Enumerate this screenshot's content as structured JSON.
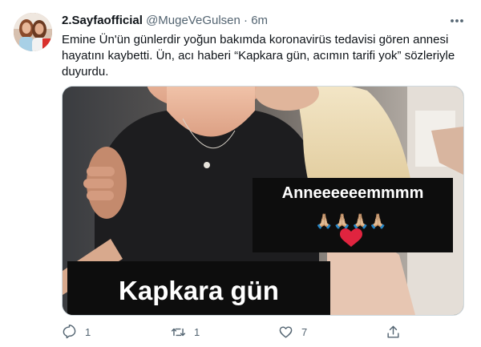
{
  "tweet": {
    "display_name": "2.Sayfaofficial",
    "handle": "@MugeVeGulsen",
    "separator": "·",
    "time": "6m",
    "text": "Emine Ün'ün günlerdir yoğun bakımda koronavirüs tedavisi gören annesi\nhayatını kaybetti. Ün, acı haberi “Kapkara gün, acımın tarifi yok” sözleriyle\nduyurdu.",
    "media": {
      "story_caption": "Anneeeeeemmmm",
      "emoji_line": "🙏🏼🙏🏼🙏🏼🙏🏼",
      "heart": "❤️",
      "bottom_caption": "Kapkara gün"
    },
    "actions": {
      "reply_count": "1",
      "retweet_count": "1",
      "like_count": "7",
      "share_count": ""
    },
    "icons": {
      "more": "more-icon",
      "reply": "reply-icon",
      "retweet": "retweet-icon",
      "like": "heart-icon",
      "share": "share-icon"
    },
    "colors": {
      "text": "#0f1419",
      "secondary": "#536471",
      "heart": "#e0243f"
    }
  }
}
